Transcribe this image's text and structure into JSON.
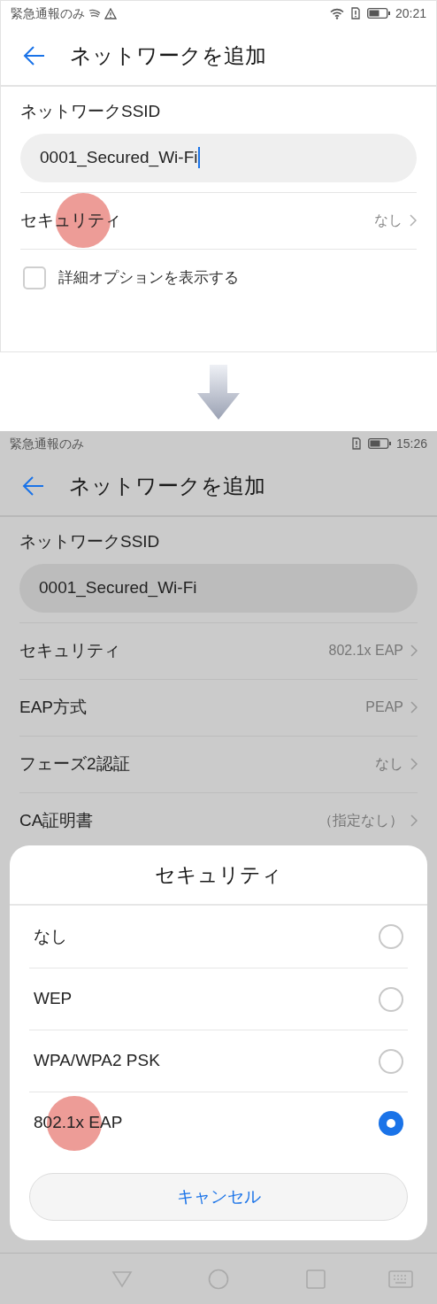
{
  "screens": [
    {
      "dimmed": false,
      "status_bar": {
        "carrier": "緊急通報のみ",
        "wifi": true,
        "alert": true,
        "time": "20:21"
      },
      "header": {
        "title": "ネットワークを追加"
      },
      "ssid_label": "ネットワークSSID",
      "ssid_field": {
        "value": "0001_Secured_Wi-Fi",
        "focused": true
      },
      "settings": [
        {
          "label": "セキュリティ",
          "value": "なし",
          "tapped": true
        }
      ],
      "advanced_option": {
        "label": "詳細オプションを表示する",
        "checked": false
      }
    },
    {
      "dimmed": true,
      "status_bar": {
        "carrier": "緊急通報のみ",
        "wifi": false,
        "alert": false,
        "time": "15:26"
      },
      "header": {
        "title": "ネットワークを追加"
      },
      "ssid_label": "ネットワークSSID",
      "ssid_field": {
        "value": "0001_Secured_Wi-Fi",
        "focused": false
      },
      "settings": [
        {
          "label": "セキュリティ",
          "value": "802.1x EAP",
          "tapped": false
        },
        {
          "label": "EAP方式",
          "value": "PEAP",
          "tapped": false
        },
        {
          "label": "フェーズ2認証",
          "value": "なし",
          "tapped": false
        },
        {
          "label": "CA証明書",
          "value": "（指定なし）",
          "tapped": false
        }
      ],
      "dialog": {
        "title": "セキュリティ",
        "options": [
          {
            "label": "なし",
            "selected": false,
            "tapped": false
          },
          {
            "label": "WEP",
            "selected": false,
            "tapped": false
          },
          {
            "label": "WPA/WPA2 PSK",
            "selected": false,
            "tapped": false
          },
          {
            "label": "802.1x EAP",
            "selected": true,
            "tapped": true
          }
        ],
        "cancel": "キャンセル"
      }
    }
  ]
}
